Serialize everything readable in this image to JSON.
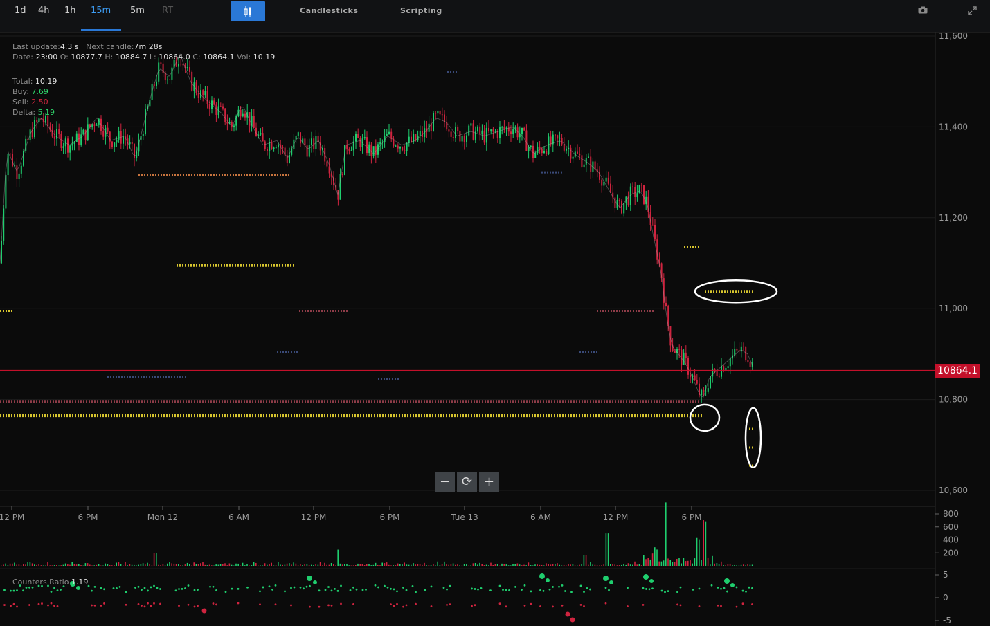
{
  "toolbar": {
    "timeframes": [
      "1d",
      "4h",
      "1h",
      "15m",
      "5m",
      "RT"
    ],
    "active_timeframe": "15m",
    "chart_type_label": "Candlesticks",
    "scripting_label": "Scripting",
    "camera_icon": "camera-icon",
    "expand_icon": "expand-icon",
    "chart_type_icon": "candlestick-icon"
  },
  "info": {
    "last_update_label": "Last update:",
    "last_update_value": "4.3 s",
    "next_candle_label": "Next candle:",
    "next_candle_value": "7m 28s",
    "date_label": "Date:",
    "date_value": "23:00",
    "o_label": "O:",
    "o_value": "10877.7",
    "h_label": "H:",
    "h_value": "10884.7",
    "l_label": "L:",
    "l_value": "10864.0",
    "c_label": "C:",
    "c_value": "10864.1",
    "vol_label": "Vol:",
    "vol_value": "10.19",
    "total_label": "Total:",
    "total_value": "10.19",
    "buy_label": "Buy:",
    "buy_value": "7.69",
    "sell_label": "Sell:",
    "sell_value": "2.50",
    "delta_label": "Delta:",
    "delta_value": "5.19",
    "counters_label": "Counters Ratio",
    "counters_value": "1.19"
  },
  "zoom": {
    "minus": "−",
    "reset": "⟳",
    "plus": "+"
  },
  "colors": {
    "up": "#1fce6e",
    "down": "#d0243f",
    "level": "#d8c62e",
    "accent": "#2a78d6",
    "price_tag": "#c3102a"
  },
  "chart_data": [
    {
      "type": "candlestick",
      "title": "",
      "last_price": 10864.1,
      "price_ticks": [
        11600,
        11400,
        11200,
        11000,
        10800,
        10600
      ],
      "ylim": [
        10570,
        11610
      ],
      "x_ticks": [
        "12 PM",
        "6 PM",
        "Mon 12",
        "6 AM",
        "12 PM",
        "6 PM",
        "Tue 13",
        "6 AM",
        "12 PM",
        "6 PM"
      ],
      "close_path": [
        [
          0,
          11100
        ],
        [
          10,
          11350
        ],
        [
          25,
          11300
        ],
        [
          45,
          11390
        ],
        [
          60,
          11420
        ],
        [
          80,
          11380
        ],
        [
          100,
          11360
        ],
        [
          120,
          11380
        ],
        [
          140,
          11420
        ],
        [
          160,
          11370
        ],
        [
          180,
          11380
        ],
        [
          195,
          11330
        ],
        [
          210,
          11420
        ],
        [
          220,
          11480
        ],
        [
          230,
          11530
        ],
        [
          245,
          11510
        ],
        [
          260,
          11560
        ],
        [
          275,
          11500
        ],
        [
          290,
          11470
        ],
        [
          305,
          11450
        ],
        [
          320,
          11430
        ],
        [
          335,
          11400
        ],
        [
          350,
          11450
        ],
        [
          365,
          11400
        ],
        [
          380,
          11360
        ],
        [
          400,
          11370
        ],
        [
          415,
          11330
        ],
        [
          430,
          11380
        ],
        [
          445,
          11350
        ],
        [
          460,
          11370
        ],
        [
          475,
          11320
        ],
        [
          488,
          11250
        ],
        [
          500,
          11360
        ],
        [
          520,
          11370
        ],
        [
          540,
          11340
        ],
        [
          560,
          11380
        ],
        [
          580,
          11360
        ],
        [
          600,
          11370
        ],
        [
          615,
          11390
        ],
        [
          630,
          11420
        ],
        [
          645,
          11410
        ],
        [
          660,
          11380
        ],
        [
          680,
          11390
        ],
        [
          700,
          11380
        ],
        [
          720,
          11390
        ],
        [
          740,
          11400
        ],
        [
          755,
          11380
        ],
        [
          770,
          11340
        ],
        [
          790,
          11360
        ],
        [
          810,
          11370
        ],
        [
          830,
          11340
        ],
        [
          850,
          11320
        ],
        [
          865,
          11300
        ],
        [
          880,
          11260
        ],
        [
          895,
          11220
        ],
        [
          910,
          11250
        ],
        [
          925,
          11260
        ],
        [
          935,
          11230
        ],
        [
          945,
          11150
        ],
        [
          955,
          11080
        ],
        [
          962,
          10990
        ],
        [
          970,
          10920
        ],
        [
          980,
          10900
        ],
        [
          990,
          10880
        ],
        [
          1000,
          10850
        ],
        [
          1008,
          10820
        ],
        [
          1015,
          10800
        ],
        [
          1025,
          10850
        ],
        [
          1040,
          10870
        ],
        [
          1055,
          10890
        ],
        [
          1070,
          10910
        ],
        [
          1080,
          10900
        ],
        [
          1090,
          10864
        ]
      ],
      "levels": [
        {
          "price": 10765,
          "x0": 0,
          "x1": 1015,
          "color": "#d8c62e",
          "weight": "heavy"
        },
        {
          "price": 10796,
          "x0": 0,
          "x1": 1010,
          "color": "#8e3c48",
          "weight": "medium"
        },
        {
          "price": 11294,
          "x0": 200,
          "x1": 418,
          "color": "#c8743e",
          "weight": "medium"
        },
        {
          "price": 11095,
          "x0": 255,
          "x1": 427,
          "color": "#d8c62e",
          "weight": "medium"
        },
        {
          "price": 11038,
          "x0": 1018,
          "x1": 1090,
          "color": "#d8c62e",
          "weight": "medium"
        },
        {
          "price": 11135,
          "x0": 988,
          "x1": 1013,
          "color": "#d8c62e",
          "weight": "light"
        },
        {
          "price": 10995,
          "x0": 0,
          "x1": 18,
          "color": "#d8c62e",
          "weight": "light"
        },
        {
          "price": 10995,
          "x0": 432,
          "x1": 503,
          "color": "#8e3c48",
          "weight": "light"
        },
        {
          "price": 10995,
          "x0": 862,
          "x1": 945,
          "color": "#8e3c48",
          "weight": "light"
        },
        {
          "price": 10850,
          "x0": 155,
          "x1": 272,
          "color": "#3a4a78",
          "weight": "light"
        },
        {
          "price": 10845,
          "x0": 546,
          "x1": 578,
          "color": "#3a4a78",
          "weight": "light"
        },
        {
          "price": 10905,
          "x0": 400,
          "x1": 432,
          "color": "#3a4a78",
          "weight": "light"
        },
        {
          "price": 10905,
          "x0": 837,
          "x1": 864,
          "color": "#3a4a78",
          "weight": "light"
        },
        {
          "price": 11300,
          "x0": 782,
          "x1": 814,
          "color": "#3a4a78",
          "weight": "light"
        },
        {
          "price": 11520,
          "x0": 646,
          "x1": 660,
          "color": "#3a4a78",
          "weight": "light"
        }
      ],
      "annotations": [
        {
          "shape": "ellipse",
          "x": 1063,
          "price": 11038
        },
        {
          "shape": "circle",
          "x": 1018,
          "price": 10760
        },
        {
          "shape": "ellipse-vertical",
          "x": 1088,
          "price": 10716
        }
      ]
    },
    {
      "type": "bar",
      "title": "",
      "ylim": [
        0,
        900
      ],
      "y_ticks": [
        800,
        600,
        400,
        200
      ],
      "peaks": [
        {
          "x": 225,
          "v": 200
        },
        {
          "x": 488,
          "v": 250
        },
        {
          "x": 845,
          "v": 160
        },
        {
          "x": 877,
          "v": 500
        },
        {
          "x": 947,
          "v": 240
        },
        {
          "x": 962,
          "v": 900
        },
        {
          "x": 1008,
          "v": 400
        },
        {
          "x": 1018,
          "v": 600
        }
      ]
    },
    {
      "type": "scatter",
      "title": "",
      "series_name": "Counters Ratio",
      "last_value": 1.19,
      "ylim": [
        -5,
        5
      ],
      "y_ticks": [
        5,
        0,
        -5
      ]
    }
  ]
}
